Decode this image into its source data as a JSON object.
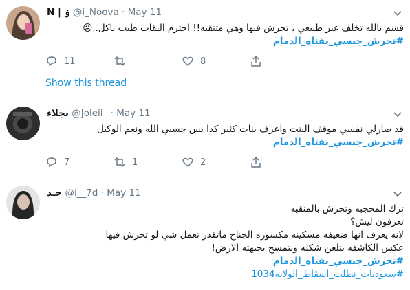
{
  "tweets": [
    {
      "name": "N | ۏ",
      "handle": "@i_Noova",
      "separator": "·",
      "date": "May 11",
      "lines": [
        "قسم بالله تخلف غير طبيعي ، تحرش فيها وهي متنقبه!! احترم النقاب طيب ياكل..",
        "#تحرش_جنسي_بفتاه_الدمام"
      ],
      "emoji": "😡",
      "replies": "11",
      "retweets": "",
      "likes": "8",
      "show_thread": "Show this thread"
    },
    {
      "name": "نجلاء",
      "handle": "@Joleii_",
      "separator": "·",
      "date": "May 11",
      "lines": [
        "قد صارلي نفسي موقف البنت واعرف بنات كثير كذا بس حسبي الله ونعم الوكيل",
        "#تحرش_جنسي_بفتاه_الدمام"
      ],
      "replies": "7",
      "retweets": "1",
      "likes": "2"
    },
    {
      "name": "حـد",
      "handle": "@i__7d",
      "separator": "·",
      "date": "May 11",
      "lines": [
        "ترك المحجبه وتحرش بالمنقبه",
        "تعرفون ليش؟",
        "لانه يعرف انها ضعيفه مسكينه مكسوره الجناح ماتقدر تعمل شي لو تحرش فيها",
        "عكس الكاشفه بتلعن شكله وبتمسح بجبهته الارض!",
        "#تحرش_جنسي_بفتاه_الدمام",
        "#سعوديات_نطلب_اسقاط_الولايه1034"
      ]
    }
  ],
  "colors": {
    "link": "#1b95e0",
    "muted": "#657786",
    "divider": "#e6ecf0"
  },
  "icons": [
    "reply-icon",
    "retweet-icon",
    "like-icon",
    "share-icon",
    "chevron-down-icon"
  ]
}
